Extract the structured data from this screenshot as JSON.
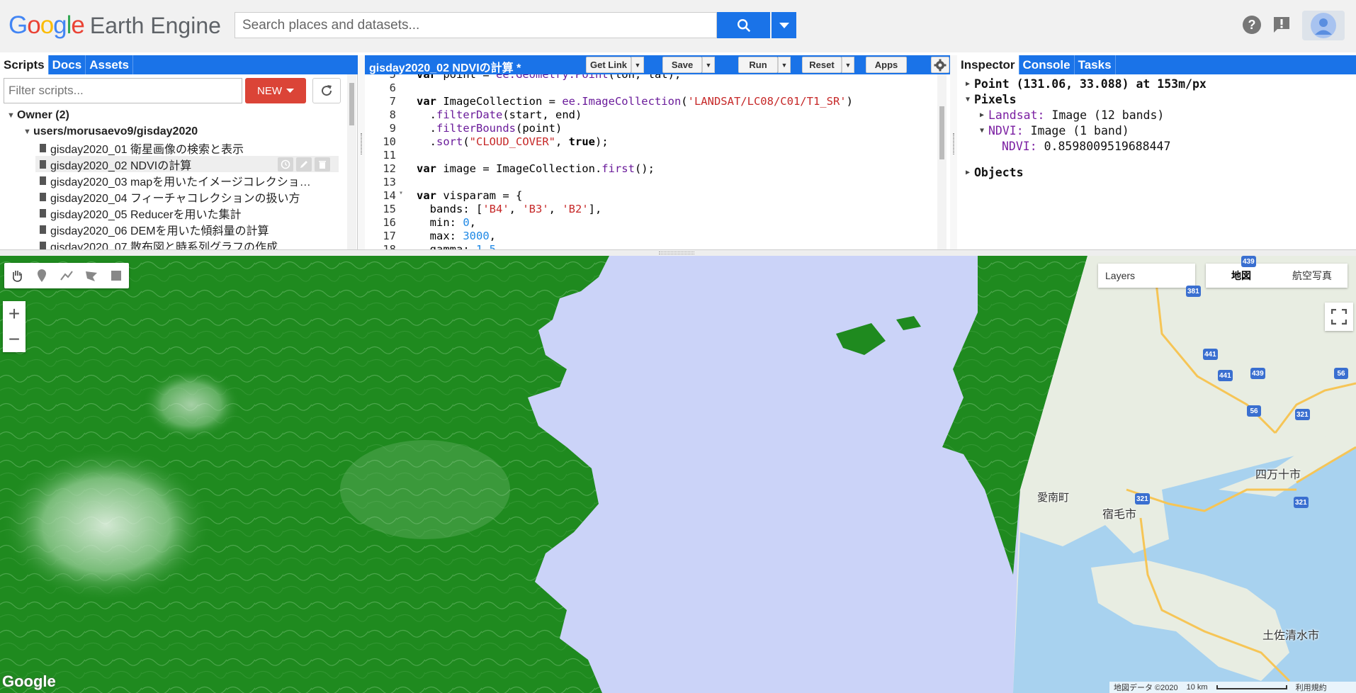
{
  "header": {
    "logo_google": [
      "G",
      "o",
      "o",
      "g",
      "l",
      "e"
    ],
    "logo_product": "Earth Engine",
    "search_placeholder": "Search places and datasets..."
  },
  "left_panel": {
    "tabs": [
      {
        "label": "Scripts",
        "active": true
      },
      {
        "label": "Docs"
      },
      {
        "label": "Assets"
      }
    ],
    "filter_placeholder": "Filter scripts...",
    "new_label": "NEW",
    "owner_label": "Owner (2)",
    "repo_label": "users/morusaevo9/gisday2020",
    "scripts": [
      "gisday2020_01 衛星画像の検索と表示",
      "gisday2020_02 NDVIの計算",
      "gisday2020_03 mapを用いたイメージコレクショ…",
      "gisday2020_04 フィーチャコレクションの扱い方",
      "gisday2020_05 Reducerを用いた集計",
      "gisday2020_06 DEMを用いた傾斜量の計算",
      "gisday2020_07 散布図と時系列グラフの作成"
    ]
  },
  "editor": {
    "title": "gisday2020_02 NDVIの計算 *",
    "buttons": {
      "get_link": "Get Link",
      "save": "Save",
      "run": "Run",
      "reset": "Reset",
      "apps": "Apps"
    }
  },
  "right_panel": {
    "tabs": [
      {
        "label": "Inspector",
        "active": true
      },
      {
        "label": "Console"
      },
      {
        "label": "Tasks"
      }
    ],
    "point": "Point (131.06, 33.088) at 153m/px",
    "pixels": "Pixels",
    "landsat_key": "Landsat:",
    "landsat_val": "Image (12 bands)",
    "ndvi_key": "NDVI:",
    "ndvi_val": "Image (1 band)",
    "ndvi_value_key": "NDVI:",
    "ndvi_value": "0.8598009519688447",
    "objects": "Objects"
  },
  "map": {
    "layers_label": "Layers",
    "map_types": [
      "地図",
      "航空写真"
    ],
    "labels": {
      "ainan": "愛南町",
      "sukumo": "宿毛市",
      "shimanto": "四万十市",
      "tosashimizu": "土佐清水市"
    },
    "route_numbers": [
      "439",
      "381",
      "441",
      "441",
      "439",
      "56",
      "56",
      "321",
      "321",
      "321"
    ],
    "google_mark": "Google",
    "attribution_data": "地図データ ©2020",
    "attribution_scale": "10 km",
    "attribution_terms": "利用規約"
  },
  "colors": {
    "accent": "#1a73e8",
    "new_button": "#db4437",
    "vegetation": "#1f8a1f",
    "water": "#c8d2f7"
  }
}
